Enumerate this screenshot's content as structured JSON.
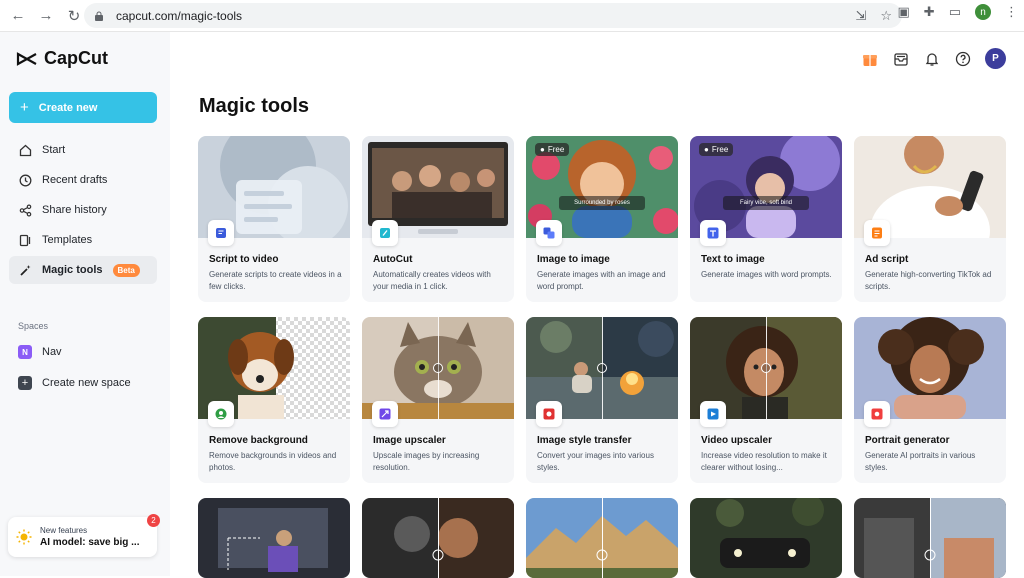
{
  "browser": {
    "url": "capcut.com/magic-tools",
    "profile_initial": "n"
  },
  "sidebar": {
    "brand": "CapCut",
    "create_label": "Create new",
    "items": [
      {
        "label": "Start",
        "icon": "home-icon"
      },
      {
        "label": "Recent drafts",
        "icon": "clock-icon"
      },
      {
        "label": "Share history",
        "icon": "share-icon"
      },
      {
        "label": "Templates",
        "icon": "template-icon"
      },
      {
        "label": "Magic tools",
        "icon": "magic-wand-icon",
        "badge": "Beta"
      }
    ],
    "spaces_label": "Spaces",
    "space_name": "Nav",
    "space_initial": "N",
    "create_space_label": "Create new space",
    "new_features": {
      "kicker": "New features",
      "title": "AI model: save big ...",
      "count": "2"
    }
  },
  "header": {
    "avatar_initial": "P"
  },
  "main": {
    "title": "Magic tools",
    "tools": [
      {
        "title": "Script to video",
        "desc": "Generate scripts to create videos in a few clicks."
      },
      {
        "title": "AutoCut",
        "desc": "Automatically creates videos with your media in 1 click."
      },
      {
        "title": "Image to image",
        "desc": "Generate images with an image and word prompt.",
        "badge": "Free",
        "caption": "Surrounded by roses"
      },
      {
        "title": "Text to image",
        "desc": "Generate images with word prompts.",
        "badge": "Free",
        "caption": "Fairy vibe, soft bind"
      },
      {
        "title": "Ad script",
        "desc": "Generate high-converting TikTok ad scripts."
      },
      {
        "title": "Remove background",
        "desc": "Remove backgrounds in videos and photos."
      },
      {
        "title": "Image upscaler",
        "desc": "Upscale images by increasing resolution."
      },
      {
        "title": "Image style transfer",
        "desc": "Convert your images into various styles."
      },
      {
        "title": "Video upscaler",
        "desc": "Increase video resolution to make it clearer without losing..."
      },
      {
        "title": "Portrait generator",
        "desc": "Generate AI portraits in various styles."
      }
    ]
  },
  "colors": {
    "accent": "#35c2e6",
    "beta": "#ff8a3d",
    "avatar": "#3c3d9c"
  }
}
